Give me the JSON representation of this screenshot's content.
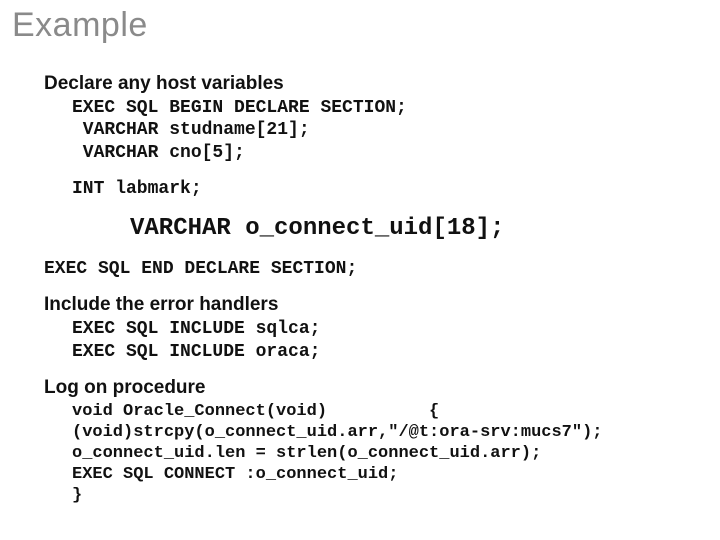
{
  "slide": {
    "title": "Example",
    "sections": {
      "declare": {
        "heading": "Declare any host variables",
        "code_top": "EXEC SQL BEGIN DECLARE SECTION;\n VARCHAR studname[21];\n VARCHAR cno[5];",
        "code_mid": "INT labmark;",
        "code_big": "VARCHAR o_connect_uid[18];",
        "code_end": "EXEC SQL END DECLARE SECTION;"
      },
      "include": {
        "heading": "Include the error handlers",
        "code": "EXEC SQL INCLUDE sqlca;\nEXEC SQL INCLUDE oraca;"
      },
      "logon": {
        "heading": "Log on procedure",
        "code": "void Oracle_Connect(void)          {\n(void)strcpy(o_connect_uid.arr,\"/@t:ora-srv:mucs7\");\no_connect_uid.len = strlen(o_connect_uid.arr);\nEXEC SQL CONNECT :o_connect_uid;\n}"
      }
    }
  }
}
